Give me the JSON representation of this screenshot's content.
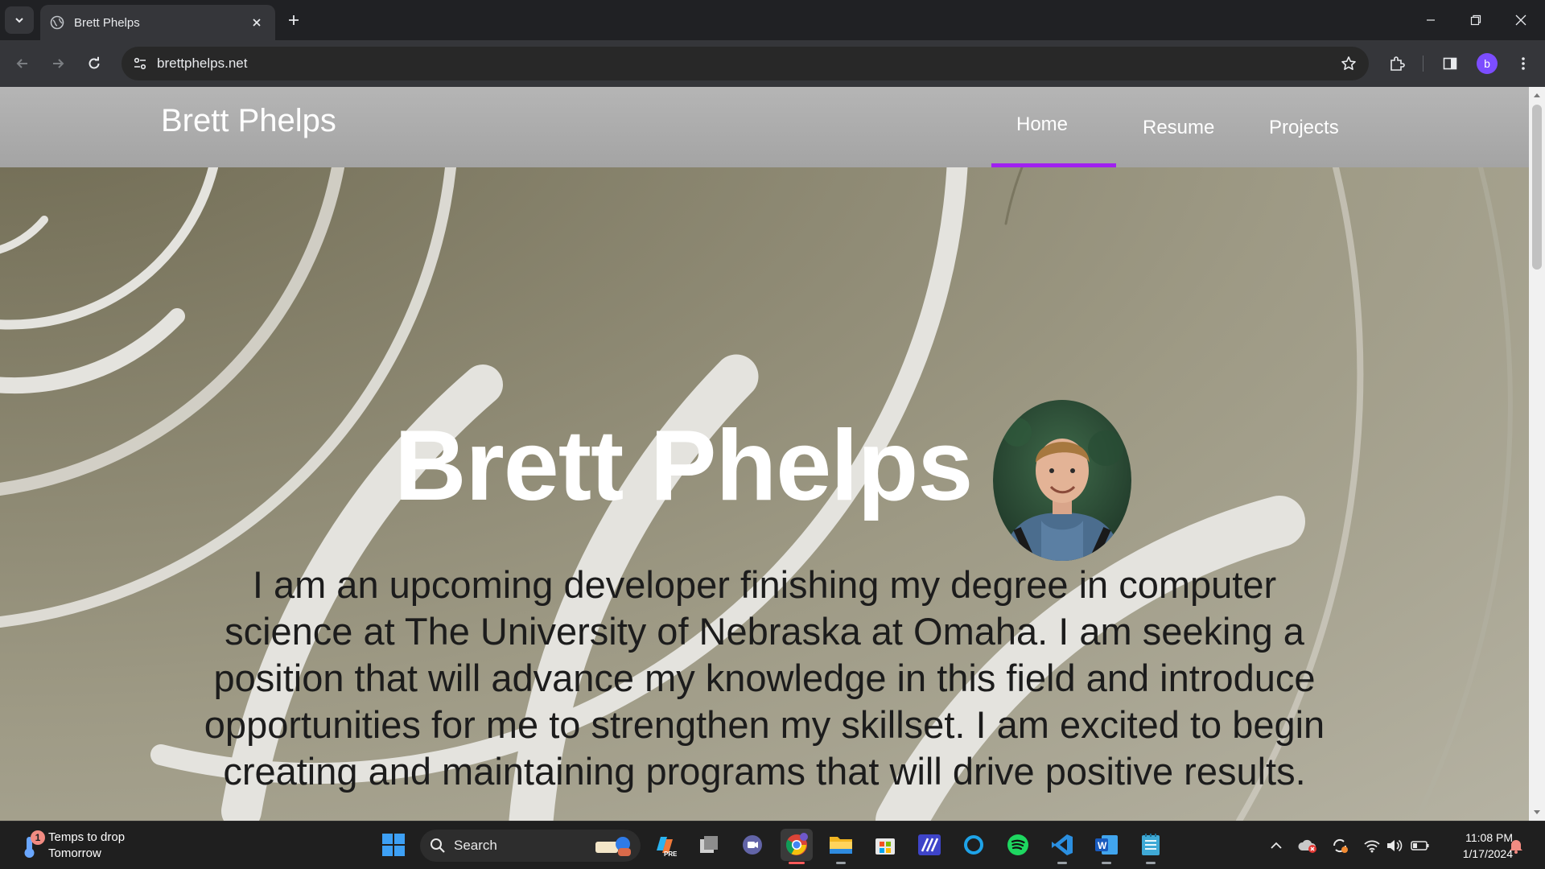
{
  "browser": {
    "tab_title": "Brett Phelps",
    "url": "brettphelps.net",
    "profile_initial": "b",
    "accent": "#7c4dff"
  },
  "site": {
    "brand": "Brett Phelps",
    "nav": [
      {
        "label": "Home",
        "active": true
      },
      {
        "label": "Resume",
        "active": false
      },
      {
        "label": "Projects",
        "active": false
      }
    ],
    "nav_active_color": "#a020f0",
    "hero_title": "Brett Phelps",
    "avatar_icon": "profile-photo",
    "intro": "I am an upcoming developer finishing my degree in computer science at The University of Nebraska at Omaha. I am seeking a position that will advance my knowledge in this field and introduce opportunities for me to strengthen my skillset. I am excited to begin creating and maintaining programs that will drive positive results."
  },
  "taskbar": {
    "weather_line1": "Temps to drop",
    "weather_line2": "Tomorrow",
    "weather_badge": "1",
    "search_label": "Search",
    "apps": [
      "start-icon",
      "copilot-icon",
      "task-view-icon",
      "teams-icon",
      "chrome-icon",
      "file-explorer-icon",
      "store-icon",
      "powerautomate-icon",
      "cortana-icon",
      "spotify-icon",
      "vscode-icon",
      "word-icon",
      "notepad-icon"
    ],
    "time": "11:08 PM",
    "date": "1/17/2024"
  }
}
